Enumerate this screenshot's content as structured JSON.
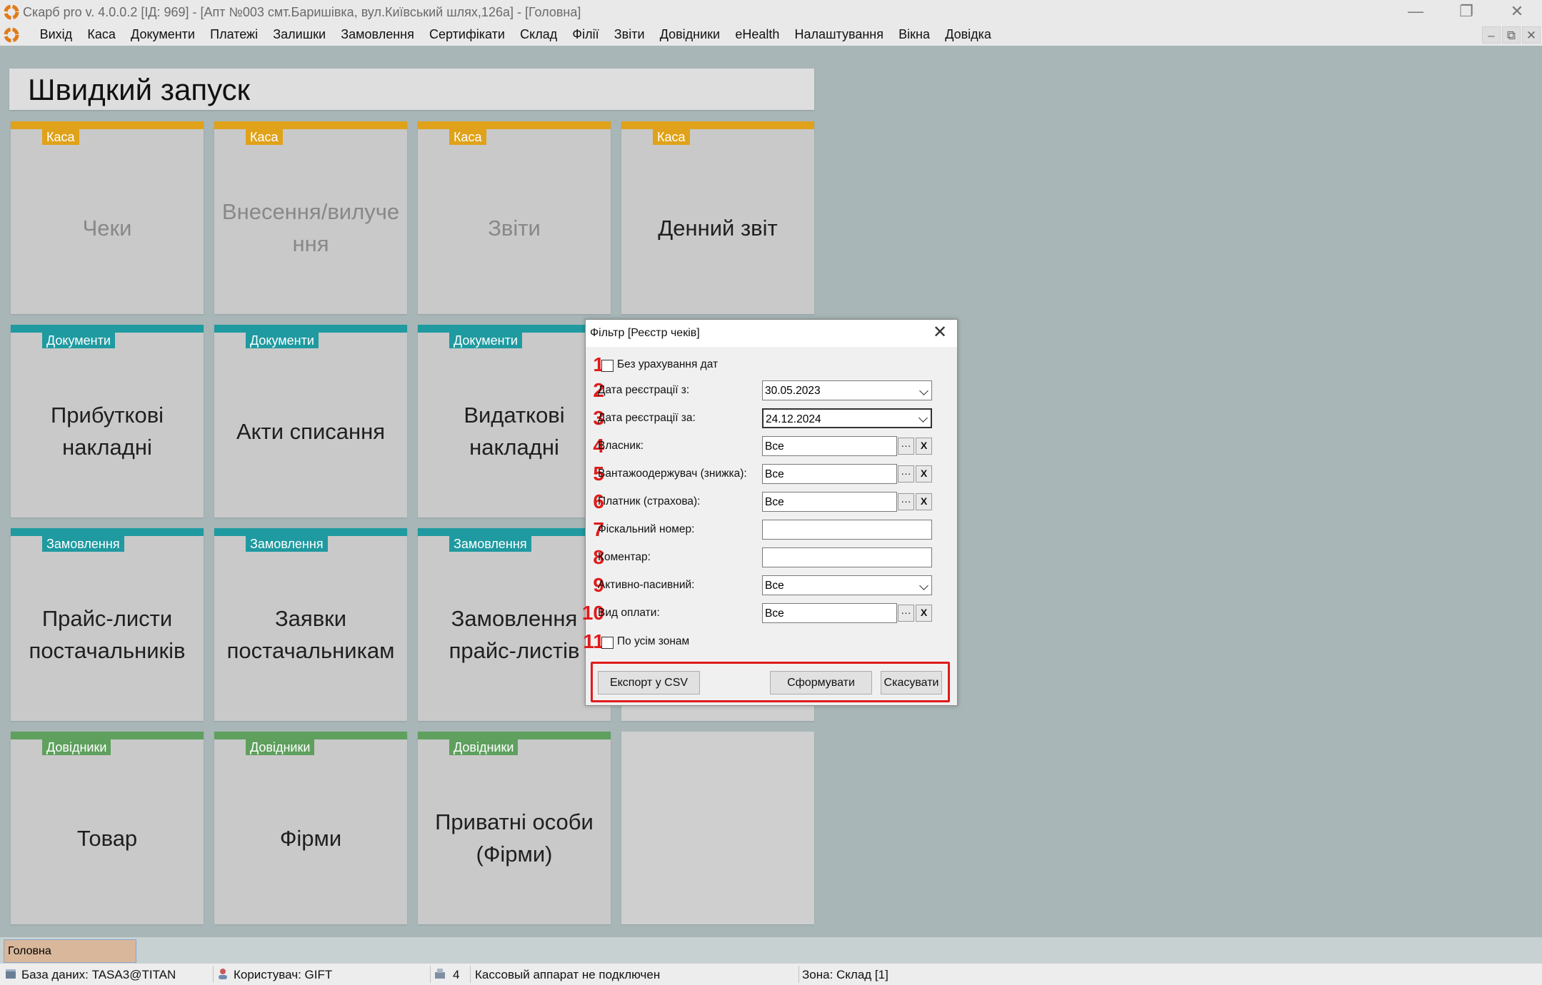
{
  "window": {
    "title": "Скарб pro v. 4.0.0.2 [ІД: 969] - [Апт №003 смт.Баришівка, вул.Київський шлях,126а] - [Головна]",
    "minimize_glyph": "—",
    "restore_glyph": "❐",
    "close_glyph": "✕"
  },
  "menu": {
    "items": [
      "Вихід",
      "Каса",
      "Документи",
      "Платежі",
      "Залишки",
      "Замовлення",
      "Сертифікати",
      "Склад",
      "Філії",
      "Звіти",
      "Довідники",
      "eHealth",
      "Налаштування",
      "Вікна",
      "Довідка"
    ],
    "mdi_minimize": "–",
    "mdi_restore": "⧉",
    "mdi_close": "✕"
  },
  "quick_launch": {
    "title": "Швидкий запуск",
    "tiles": [
      {
        "category": "Каса",
        "label": "Чеки",
        "color": "#e0a21a"
      },
      {
        "category": "Каса",
        "label": "Внесення/вилучення",
        "color": "#e0a21a"
      },
      {
        "category": "Каса",
        "label": "Звіти",
        "color": "#e0a21a"
      },
      {
        "category": "Каса",
        "label": "Денний звіт",
        "color": "#e0a21a"
      },
      {
        "category": "Документи",
        "label": "Прибуткові накладні",
        "color": "#1f9aa0"
      },
      {
        "category": "Документи",
        "label": "Акти списання",
        "color": "#1f9aa0"
      },
      {
        "category": "Документи",
        "label": "Видаткові накладні",
        "color": "#1f9aa0"
      },
      {
        "category": "Замовлення",
        "label": "Прайс-листи постачальників",
        "color": "#1f9aa0"
      },
      {
        "category": "Замовлення",
        "label": "Заявки постачальникам",
        "color": "#1f9aa0"
      },
      {
        "category": "Замовлення",
        "label": "Замовлення прайс-листів",
        "color": "#1f9aa0"
      },
      {
        "category": "Довідники",
        "label": "Товар",
        "color": "#5fa05f"
      },
      {
        "category": "Довідники",
        "label": "Фірми",
        "color": "#5fa05f"
      },
      {
        "category": "Довідники",
        "label": "Приватні особи (Фірми)",
        "color": "#5fa05f"
      }
    ]
  },
  "dialog": {
    "title": "Фільтр [Реєстр чеків]",
    "close_glyph": "✕",
    "rows": [
      {
        "num": "1",
        "type": "checkbox",
        "label": "Без урахування дат"
      },
      {
        "num": "2",
        "type": "date",
        "label": "Дата реєстрації з:",
        "value": "30.05.2023"
      },
      {
        "num": "3",
        "type": "date",
        "label": "Дата реєстрації за:",
        "value": "24.12.2024"
      },
      {
        "num": "4",
        "type": "lookup",
        "label": "Власник:",
        "value": "Все"
      },
      {
        "num": "5",
        "type": "lookup",
        "label": "Вантажоодержувач (знижка):",
        "value": "Все"
      },
      {
        "num": "6",
        "type": "lookup",
        "label": "Платник (страхова):",
        "value": "Все"
      },
      {
        "num": "7",
        "type": "text",
        "label": "Фіскальний номер:",
        "value": ""
      },
      {
        "num": "8",
        "type": "text",
        "label": "Коментар:",
        "value": ""
      },
      {
        "num": "9",
        "type": "select",
        "label": "Активно-пасивний:",
        "value": "Все"
      },
      {
        "num": "10",
        "type": "lookup",
        "label": "Вид оплати:",
        "value": "Все"
      },
      {
        "num": "11",
        "type": "checkbox",
        "label": "По усім зонам"
      }
    ],
    "lookup_button": "···",
    "clear_button": "X",
    "buttons": {
      "export": "Експорт у CSV",
      "generate": "Сформувати",
      "cancel": "Скасувати"
    }
  },
  "taskbar": {
    "active": "Головна"
  },
  "status": {
    "database": "База даних: TASA3@TITAN",
    "user": "Користувач: GIFT",
    "count": "4",
    "cash_register": "Кассовый аппарат не подключен",
    "zone": "Зона: Склад [1]"
  }
}
